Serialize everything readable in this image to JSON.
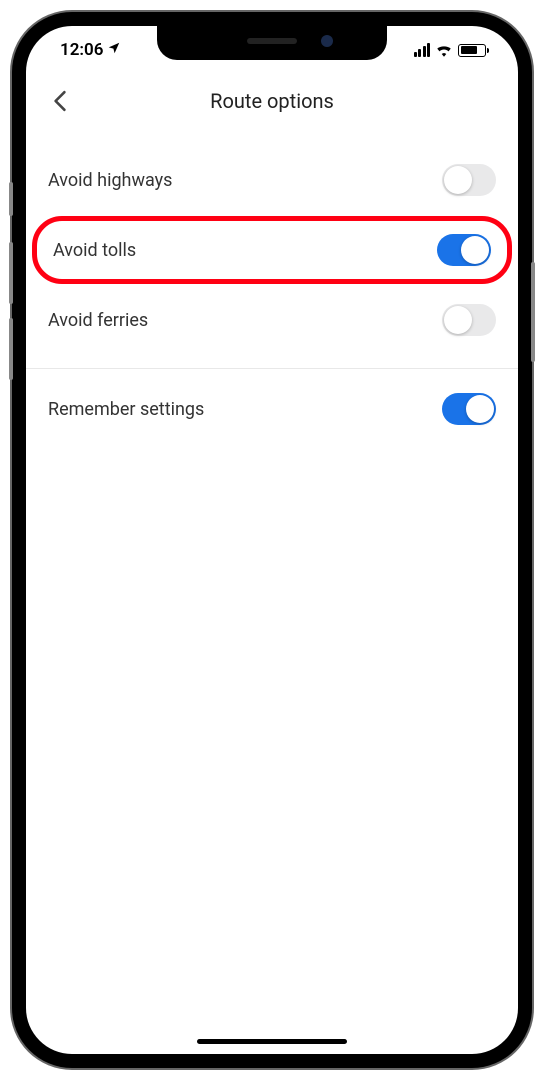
{
  "status": {
    "time": "12:06"
  },
  "header": {
    "title": "Route options"
  },
  "options": [
    {
      "key": "avoid-highways",
      "label": "Avoid highways",
      "on": false,
      "highlighted": false
    },
    {
      "key": "avoid-tolls",
      "label": "Avoid tolls",
      "on": true,
      "highlighted": true
    },
    {
      "key": "avoid-ferries",
      "label": "Avoid ferries",
      "on": false,
      "highlighted": false
    }
  ],
  "remember": {
    "label": "Remember settings",
    "on": true
  },
  "colors": {
    "accent": "#1a73e8",
    "highlight": "#ff0013"
  }
}
